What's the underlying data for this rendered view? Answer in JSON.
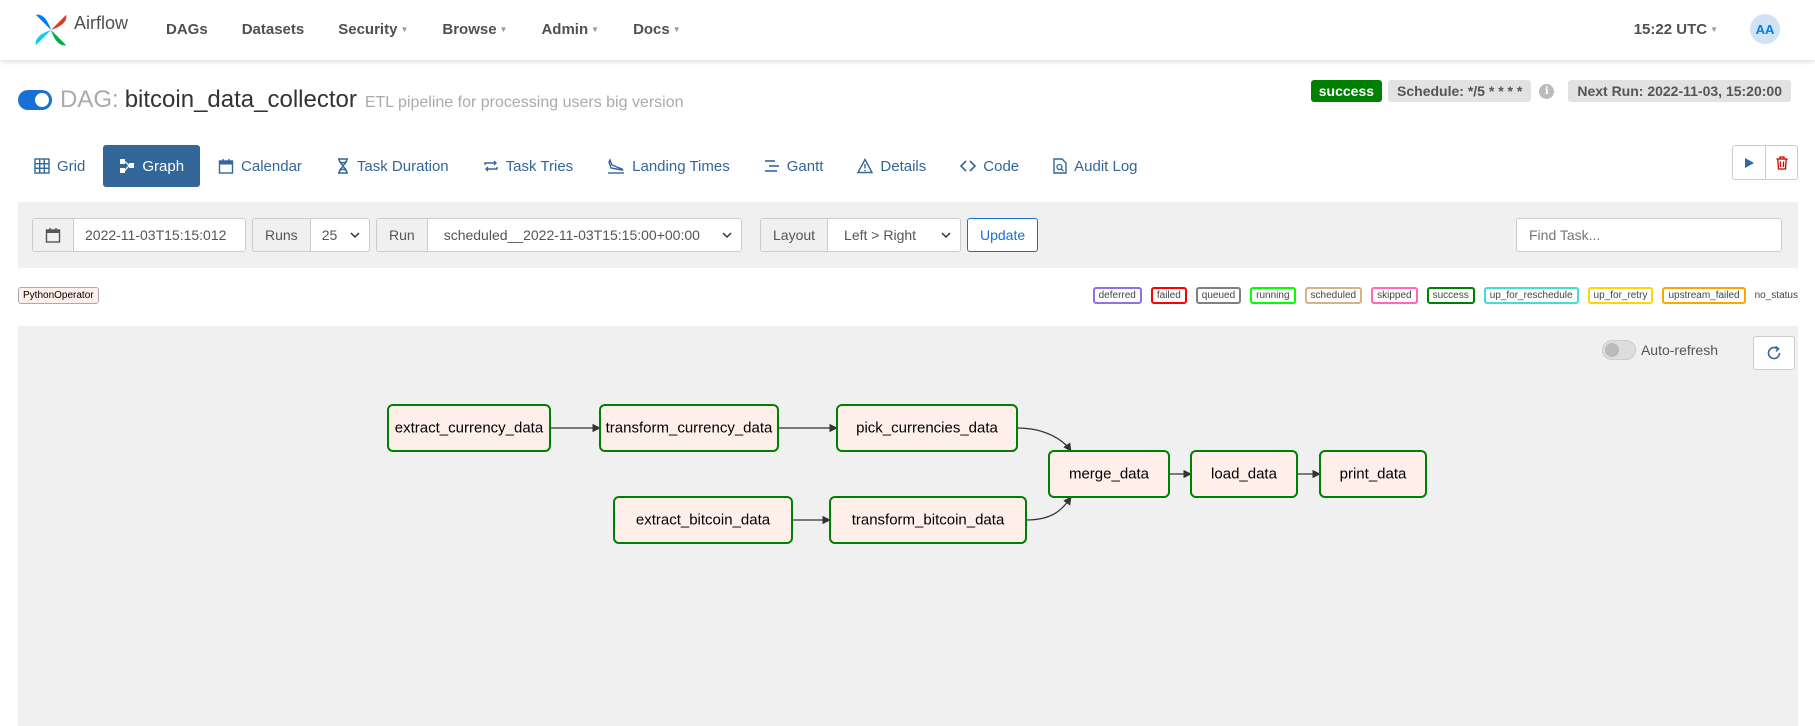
{
  "navbar": {
    "brand": "Airflow",
    "items": [
      {
        "label": "DAGs",
        "dropdown": false
      },
      {
        "label": "Datasets",
        "dropdown": false
      },
      {
        "label": "Security",
        "dropdown": true
      },
      {
        "label": "Browse",
        "dropdown": true
      },
      {
        "label": "Admin",
        "dropdown": true
      },
      {
        "label": "Docs",
        "dropdown": true
      }
    ],
    "time": "15:22 UTC",
    "avatar": "AA"
  },
  "dag": {
    "prefix": "DAG:",
    "id": "bitcoin_data_collector",
    "description": "ETL pipeline for processing users big version",
    "paused": false
  },
  "run_info": {
    "state": "success",
    "schedule": "Schedule: */5 * * * *",
    "next_run": "Next Run: 2022-11-03, 15:20:00"
  },
  "tabs": [
    {
      "label": "Grid",
      "icon": "grid-icon",
      "active": false
    },
    {
      "label": "Graph",
      "icon": "graph-icon",
      "active": true
    },
    {
      "label": "Calendar",
      "icon": "calendar-icon",
      "active": false
    },
    {
      "label": "Task Duration",
      "icon": "hourglass-icon",
      "active": false
    },
    {
      "label": "Task Tries",
      "icon": "repeat-icon",
      "active": false
    },
    {
      "label": "Landing Times",
      "icon": "plane-landing-icon",
      "active": false
    },
    {
      "label": "Gantt",
      "icon": "gantt-icon",
      "active": false
    },
    {
      "label": "Details",
      "icon": "warning-triangle-icon",
      "active": false
    },
    {
      "label": "Code",
      "icon": "code-icon",
      "active": false
    },
    {
      "label": "Audit Log",
      "icon": "file-search-icon",
      "active": false
    }
  ],
  "filters": {
    "base_date": "2022-11-03T15:15:012",
    "runs_label": "Runs",
    "runs_value": "25",
    "run_label": "Run",
    "run_value": "scheduled__2022-11-03T15:15:00+00:00",
    "layout_label": "Layout",
    "layout_value": "Left > Right",
    "update_label": "Update",
    "find_task_placeholder": "Find Task..."
  },
  "operator_legend": "PythonOperator",
  "state_legend": [
    {
      "label": "deferred",
      "color": "#9370db"
    },
    {
      "label": "failed",
      "color": "#ff0000"
    },
    {
      "label": "queued",
      "color": "#808080"
    },
    {
      "label": "running",
      "color": "#00ff00"
    },
    {
      "label": "scheduled",
      "color": "#d2b48c"
    },
    {
      "label": "skipped",
      "color": "#ff69b4"
    },
    {
      "label": "success",
      "color": "#008000"
    },
    {
      "label": "up_for_reschedule",
      "color": "#40e0d0"
    },
    {
      "label": "up_for_retry",
      "color": "#ffd700"
    },
    {
      "label": "upstream_failed",
      "color": "#ffa500"
    }
  ],
  "no_status_label": "no_status",
  "graph": {
    "auto_refresh_label": "Auto-refresh",
    "tasks": [
      {
        "id": "extract_currency_data",
        "state": "success"
      },
      {
        "id": "transform_currency_data",
        "state": "success"
      },
      {
        "id": "pick_currencies_data",
        "state": "success"
      },
      {
        "id": "extract_bitcoin_data",
        "state": "success"
      },
      {
        "id": "transform_bitcoin_data",
        "state": "success"
      },
      {
        "id": "merge_data",
        "state": "success"
      },
      {
        "id": "load_data",
        "state": "success"
      },
      {
        "id": "print_data",
        "state": "success"
      }
    ],
    "edges": [
      [
        "extract_currency_data",
        "transform_currency_data"
      ],
      [
        "transform_currency_data",
        "pick_currencies_data"
      ],
      [
        "pick_currencies_data",
        "merge_data"
      ],
      [
        "extract_bitcoin_data",
        "transform_bitcoin_data"
      ],
      [
        "transform_bitcoin_data",
        "merge_data"
      ],
      [
        "merge_data",
        "load_data"
      ],
      [
        "load_data",
        "print_data"
      ]
    ]
  },
  "colors": {
    "brand_blue": "#017cee",
    "tab_active": "#336699",
    "success": "#008000",
    "node_fill": "#ffefeb"
  }
}
